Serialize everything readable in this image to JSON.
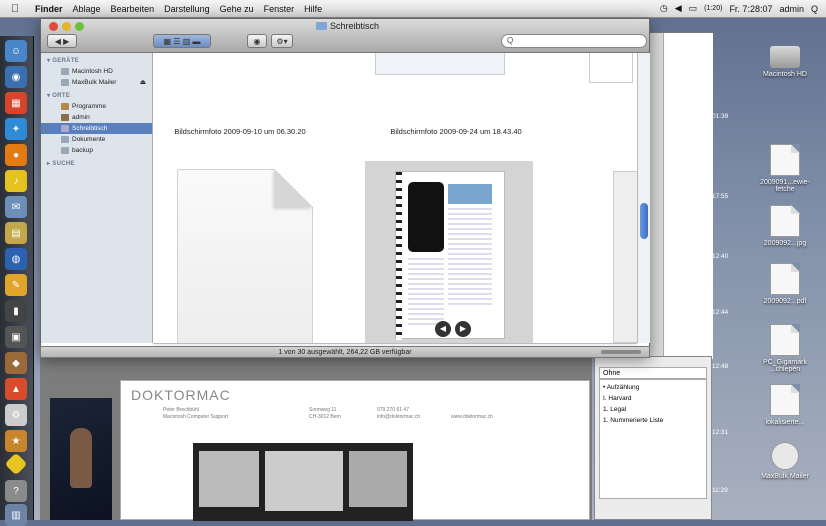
{
  "menubar": {
    "apple": "",
    "items": [
      "Finder",
      "Ablage",
      "Bearbeiten",
      "Darstellung",
      "Gehe zu",
      "Fenster",
      "Hilfe"
    ],
    "battery": "(1:20)",
    "clock": "Fr. 7:28:07",
    "user": "admin",
    "search_glyph": "Q"
  },
  "desktop": {
    "icons": [
      {
        "label": "Macintosh HD",
        "icon": "hard-disk-icon"
      },
      {
        "label": "2009091...ewie-fetche",
        "icon": "document-icon"
      },
      {
        "label": "2009092...jpg",
        "icon": "document-icon"
      },
      {
        "label": "2009092...pdf",
        "icon": "document-icon"
      },
      {
        "label": "PC_Gigamark ...chlepen",
        "icon": "document-icon"
      },
      {
        "label": "lokalisierte...",
        "icon": "document-icon"
      },
      {
        "label": "MaxBulk Mailer",
        "icon": "disk-image-icon"
      }
    ]
  },
  "finder": {
    "title": "Schreibtisch",
    "search_placeholder": "Q",
    "sidebar": {
      "sections": [
        {
          "title": "GERÄTE",
          "items": [
            "Macintosh HD",
            "MaxBulk Mailer"
          ]
        },
        {
          "title": "ORTE",
          "items": [
            "Programme",
            "admin",
            "Schreibtisch",
            "Dokumente",
            "backup"
          ]
        },
        {
          "title": "SUCHE",
          "items": []
        }
      ],
      "selected": "Schreibtisch"
    },
    "files": [
      {
        "name": "Bildschirmfoto 2009-09-10 um 06.30.20"
      },
      {
        "name": "Bildschirmfoto 2009-09-24 um 18.43.40"
      }
    ],
    "status": "1 von 30 ausgewählt, 264,22 GB verfügbar"
  },
  "pages_doc": {
    "logo": "DOKTORMAC",
    "company_line1": "Peter Brechbühl",
    "company_line2": "Macintosh Computer Support",
    "address1": "Sonnweg 11",
    "address2": "CH-3012 Bern",
    "phone": "079 270 61 47",
    "email": "info@doktormac.ch",
    "web": "www.doktormac.ch"
  },
  "inspector": {
    "header": "Ohne",
    "list": [
      "• Aufzählung",
      "I. Harvard",
      "1. Legal",
      "1. Nummerierte Liste"
    ]
  }
}
